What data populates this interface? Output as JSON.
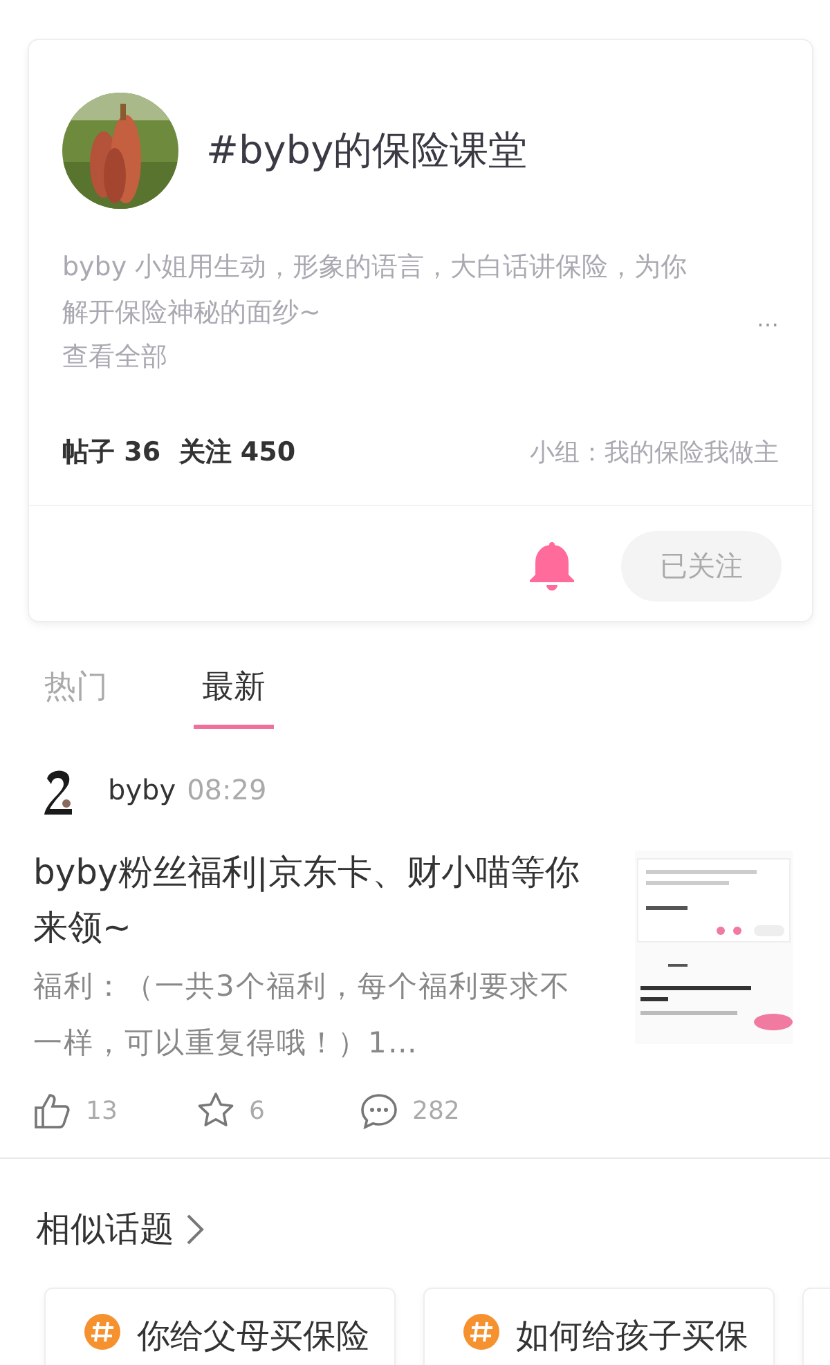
{
  "topic": {
    "title": "#byby的保险课堂",
    "description": "byby 小姐用生动，形象的语言，大白话讲保险，为你解开保险神秘的面纱~",
    "more_dots": "…",
    "view_all": "查看全部",
    "stats": "帖子 36  关注 450",
    "group": "小组：我的保险我做主",
    "notify_on": true,
    "follow_button": {
      "label": "已关注",
      "followed": true
    }
  },
  "tabs": [
    {
      "label": "热门",
      "selected": false
    },
    {
      "label": "最新",
      "selected": true
    }
  ],
  "posts": [
    {
      "author": "byby",
      "time": "08:29",
      "title": "byby粉丝福利|京东卡、财小喵等你来领~",
      "excerpt": "福利：（一共3个福利，每个福利要求不一样，可以重复得哦！）1…",
      "likes": "13",
      "favorites": "6",
      "comments": "282"
    }
  ],
  "similar": {
    "title": "相似话题",
    "cards": [
      {
        "title": "你给父母买保险"
      },
      {
        "title": "如何给孩子买保"
      }
    ]
  }
}
